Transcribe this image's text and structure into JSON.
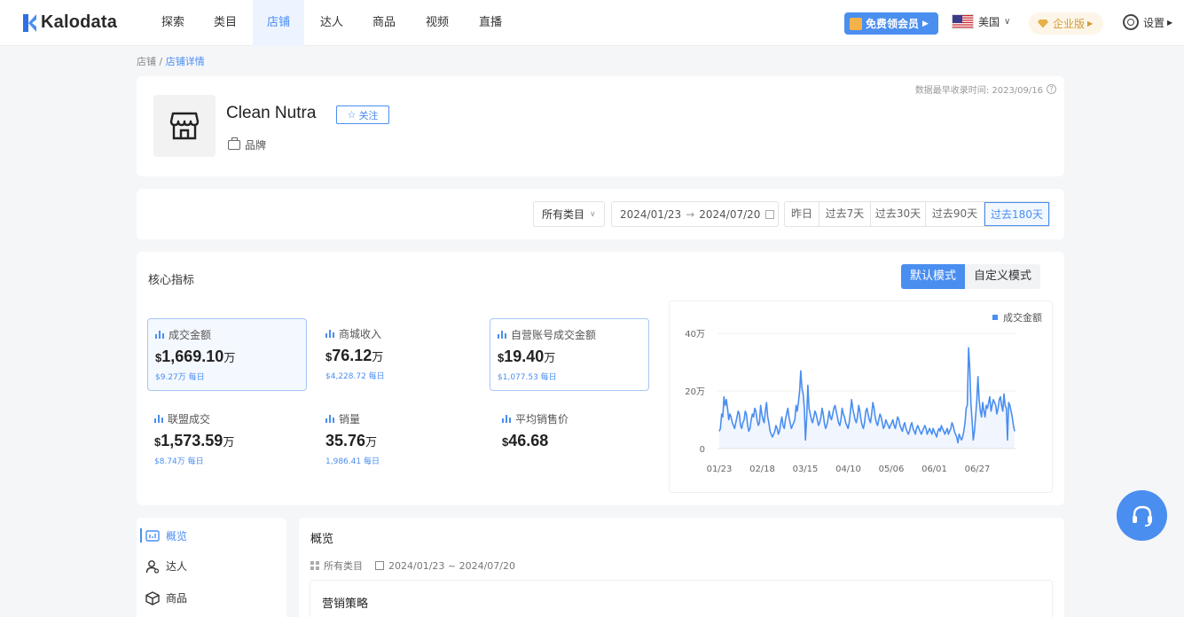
{
  "app": {
    "name": "Kalodata"
  },
  "nav": {
    "items": [
      {
        "label": "探索",
        "active": false
      },
      {
        "label": "类目",
        "active": false
      },
      {
        "label": "店铺",
        "active": true
      },
      {
        "label": "达人",
        "active": false
      },
      {
        "label": "商品",
        "active": false
      },
      {
        "label": "视频",
        "active": false
      },
      {
        "label": "直播",
        "active": false
      }
    ],
    "vip_label": "免费领会员",
    "region_label": "美国",
    "enterprise_label": "企业版",
    "settings_label": "设置"
  },
  "breadcrumb": {
    "parent": "店铺",
    "separator": " / ",
    "current": "店铺详情"
  },
  "store": {
    "name": "Clean Nutra",
    "follow_label": "关注",
    "type_label": "品牌",
    "data_note": "数据最早收录时间: 2023/09/16"
  },
  "filters": {
    "category": "所有类目",
    "date_start": "2024/01/23",
    "date_arrow": "→",
    "date_end": "2024/07/20",
    "quick_ranges": [
      {
        "label": "昨日",
        "active": false
      },
      {
        "label": "过去7天",
        "active": false
      },
      {
        "label": "过去30天",
        "active": false
      },
      {
        "label": "过去90天",
        "active": false
      },
      {
        "label": "过去180天",
        "active": true
      }
    ]
  },
  "metrics_section": {
    "title": "核心指标",
    "modes": [
      {
        "label": "默认模式",
        "active": true
      },
      {
        "label": "自定义模式",
        "active": false
      }
    ],
    "cards": [
      {
        "label": "成交金额",
        "currency": "$",
        "value": "1,669.10",
        "unit": "万",
        "sub": "$9.27万 每日"
      },
      {
        "label": "商城收入",
        "currency": "$",
        "value": "76.12",
        "unit": "万",
        "sub": "$4,228.72 每日"
      },
      {
        "label": "自营账号成交金额",
        "currency": "$",
        "value": "19.40",
        "unit": "万",
        "sub": "$1,077.53 每日"
      },
      {
        "label": "联盟成交",
        "currency": "$",
        "value": "1,573.59",
        "unit": "万",
        "sub": "$8.74万 每日"
      },
      {
        "label": "销量",
        "currency": "",
        "value": "35.76",
        "unit": "万",
        "sub": "1,986.41 每日"
      },
      {
        "label": "平均销售价",
        "currency": "$",
        "value": "46.68",
        "unit": "",
        "sub": ""
      }
    ]
  },
  "chart_data": {
    "type": "area",
    "title": "",
    "xlabel": "",
    "ylabel": "",
    "legend": "top-right",
    "color": "#4a8ef0",
    "x_ticks": [
      "01/23",
      "02/18",
      "03/15",
      "04/10",
      "05/06",
      "06/01",
      "06/27"
    ],
    "y_ticks": [
      "40万",
      "20万",
      "0"
    ],
    "ylim": [
      0,
      40
    ],
    "series": [
      {
        "name": "成交金额",
        "unit": "万",
        "values": [
          6,
          7,
          12,
          11,
          18,
          15,
          17,
          14,
          10,
          12,
          11,
          9,
          8,
          7,
          9,
          11,
          13,
          12,
          8,
          7,
          9,
          10,
          13,
          12,
          8,
          6,
          7,
          10,
          12,
          11,
          14,
          13,
          10,
          8,
          9,
          15,
          12,
          10,
          9,
          13,
          16,
          11,
          9,
          6,
          5,
          4,
          5,
          6,
          8,
          7,
          5,
          6,
          9,
          11,
          8,
          7,
          10,
          12,
          14,
          11,
          9,
          7,
          8,
          9,
          10,
          15,
          13,
          16,
          20,
          27,
          21,
          19,
          14,
          3,
          11,
          22,
          14,
          12,
          10,
          9,
          11,
          13,
          12,
          10,
          8,
          9,
          11,
          14,
          12,
          9,
          7,
          8,
          10,
          13,
          11,
          10,
          12,
          14,
          15,
          13,
          11,
          9,
          8,
          10,
          14,
          12,
          11,
          9,
          8,
          7,
          9,
          13,
          17,
          14,
          12,
          10,
          9,
          11,
          15,
          13,
          10,
          8,
          7,
          9,
          13,
          14,
          12,
          10,
          9,
          12,
          16,
          14,
          11,
          9,
          8,
          10,
          12,
          11,
          9,
          7,
          8,
          10,
          9,
          8,
          7,
          8,
          9,
          10,
          8,
          7,
          9,
          11,
          10,
          8,
          7,
          6,
          8,
          9,
          7,
          6,
          5,
          6,
          8,
          9,
          7,
          6,
          5,
          7,
          8,
          7,
          6,
          5,
          6,
          7,
          8,
          7,
          5,
          6,
          7,
          6,
          5,
          7,
          6,
          5,
          4,
          6,
          7,
          6,
          8,
          7,
          6,
          5,
          6,
          7,
          5,
          6,
          7,
          9,
          8,
          6,
          5,
          4,
          2,
          5,
          4,
          3,
          4,
          6,
          9,
          14,
          15,
          35,
          28,
          16,
          10,
          3,
          6,
          11,
          17,
          25,
          17,
          13,
          11,
          16,
          13,
          11,
          15,
          14,
          16,
          18,
          13,
          15,
          17,
          16,
          15,
          12,
          14,
          17,
          18,
          15,
          13,
          19,
          15,
          14,
          3,
          16,
          15,
          13,
          11,
          8,
          6
        ]
      }
    ]
  },
  "sidebar": {
    "items": [
      {
        "label": "概览",
        "active": true
      },
      {
        "label": "达人",
        "active": false
      },
      {
        "label": "商品",
        "active": false
      }
    ]
  },
  "overview": {
    "title": "概览",
    "category": "所有类目",
    "date_range": "2024/01/23 ~ 2024/07/20",
    "strategy_title": "营销策略"
  }
}
